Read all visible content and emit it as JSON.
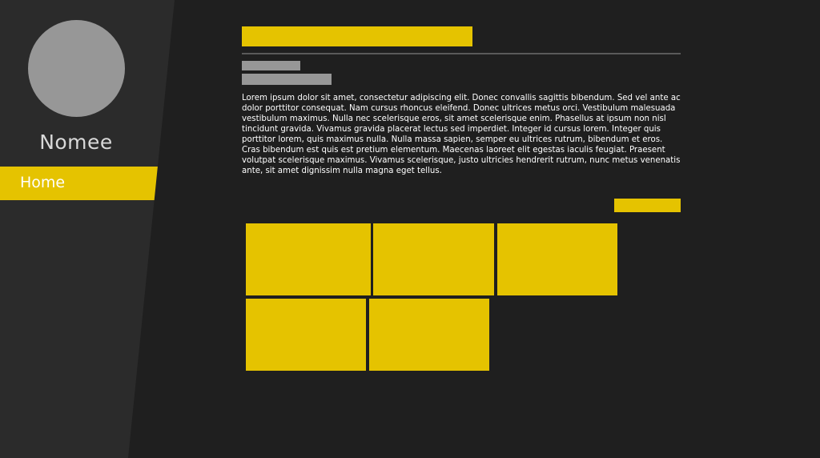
{
  "colors": {
    "background": "#1f1f1f",
    "sidebar": "#2b2b2b",
    "accent": "#e5c300",
    "placeholder_gray": "#979797",
    "divider": "#5a5a5a",
    "text": "#ffffff"
  },
  "sidebar": {
    "name": "Nomee",
    "nav": [
      {
        "label": "Home",
        "active": true
      }
    ]
  },
  "main": {
    "body_text": "Lorem ipsum dolor sit amet, consectetur adipiscing elit. Donec convallis sagittis bibendum. Sed vel ante ac dolor porttitor consequat. Nam cursus rhoncus eleifend. Donec ultrices metus orci. Vestibulum malesuada vestibulum maximus. Nulla nec scelerisque eros, sit amet scelerisque enim. Phasellus at ipsum non nisl tincidunt gravida. Vivamus gravida placerat lectus sed imperdiet. Integer id cursus lorem. Integer quis porttitor lorem, quis maximus nulla. Nulla massa sapien, semper eu ultrices rutrum, bibendum et eros. Cras bibendum est quis est pretium elementum. Maecenas laoreet elit egestas iaculis feugiat. Praesent volutpat scelerisque maximus. Vivamus scelerisque, justo ultricies hendrerit rutrum, nunc metus venenatis ante, sit amet dignissim nulla magna eget tellus."
  }
}
